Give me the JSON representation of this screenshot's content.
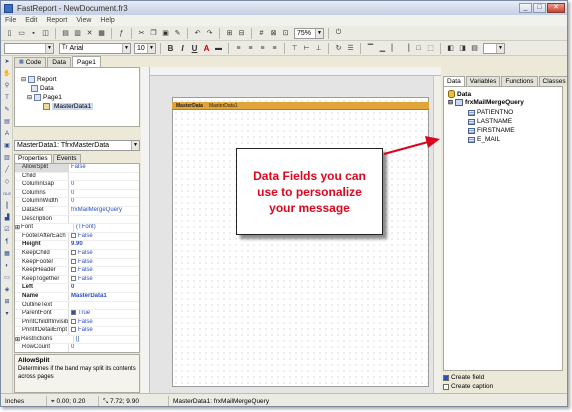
{
  "window": {
    "title": "FastReport - NewDocument.fr3"
  },
  "menu": [
    "File",
    "Edit",
    "Report",
    "View",
    "Help"
  ],
  "toolbar": {
    "zoom": "75%",
    "font_name": "Arial",
    "font_size": "10",
    "bold": "B",
    "italic": "I",
    "underline": "U",
    "font_color": "A"
  },
  "doc_tabs": [
    "Code",
    "Data",
    "Page1"
  ],
  "report_tree": {
    "report": "Report",
    "data": "Data",
    "page": "Page1",
    "band": "MasterData1"
  },
  "object_combo": "MasterData1: TfrxMasterData",
  "prop_tabs": [
    "Properties",
    "Events"
  ],
  "properties": [
    {
      "name": "AllowSplit",
      "value": "False",
      "style": "sel"
    },
    {
      "name": "Child",
      "value": ""
    },
    {
      "name": "ColumnGap",
      "value": "0"
    },
    {
      "name": "Columns",
      "value": "0"
    },
    {
      "name": "ColumnWidth",
      "value": "0"
    },
    {
      "name": "DataSet",
      "value": "frxMailMergeQuery"
    },
    {
      "name": "Description",
      "value": ""
    },
    {
      "name": "Font",
      "value": "(TFont)",
      "style": "group"
    },
    {
      "name": "FooterAfterEach",
      "value": "False",
      "check": "off"
    },
    {
      "name": "Height",
      "value": "9.90",
      "style": "bold"
    },
    {
      "name": "KeepChild",
      "value": "False",
      "check": "off"
    },
    {
      "name": "KeepFooter",
      "value": "False",
      "check": "off"
    },
    {
      "name": "KeepHeader",
      "value": "False",
      "check": "off"
    },
    {
      "name": "KeepTogether",
      "value": "False",
      "check": "off"
    },
    {
      "name": "Left",
      "value": "0",
      "style": "bold"
    },
    {
      "name": "Name",
      "value": "MasterData1",
      "style": "bold"
    },
    {
      "name": "OutlineText",
      "value": ""
    },
    {
      "name": "ParentFont",
      "value": "True",
      "check": "on"
    },
    {
      "name": "PrintChildIfInvisib",
      "value": "False",
      "check": "off"
    },
    {
      "name": "PrintIfDetailEmpt",
      "value": "False",
      "check": "off"
    },
    {
      "name": "Restrictions",
      "value": "[]",
      "style": "group"
    },
    {
      "name": "RowCount",
      "value": "0"
    }
  ],
  "prop_desc": {
    "title": "AllowSplit",
    "text": "Determines if the band may split its contents across pages"
  },
  "band": {
    "label": "MasterData",
    "sub": "MasterData1"
  },
  "callout": "Data Fields you can use to personalize your message",
  "right_tabs": [
    "Data",
    "Variables",
    "Functions",
    "Classes"
  ],
  "data_tree": {
    "root": "Data",
    "query": "frxMailMergeQuery",
    "fields": [
      "PATIENTNO",
      "LASTNAME",
      "FIRSTNAME",
      "E_MAIL"
    ]
  },
  "options": [
    {
      "label": "Create field",
      "checked": true
    },
    {
      "label": "Create caption",
      "checked": false
    }
  ],
  "status": {
    "units": "Inches",
    "pos": "0.00; 0.20",
    "size": "7.72; 9.90",
    "object": "MasterData1: frxMailMergeQuery"
  },
  "colors": {
    "callout_text": "#e0061e",
    "band": "#e0a43a"
  }
}
